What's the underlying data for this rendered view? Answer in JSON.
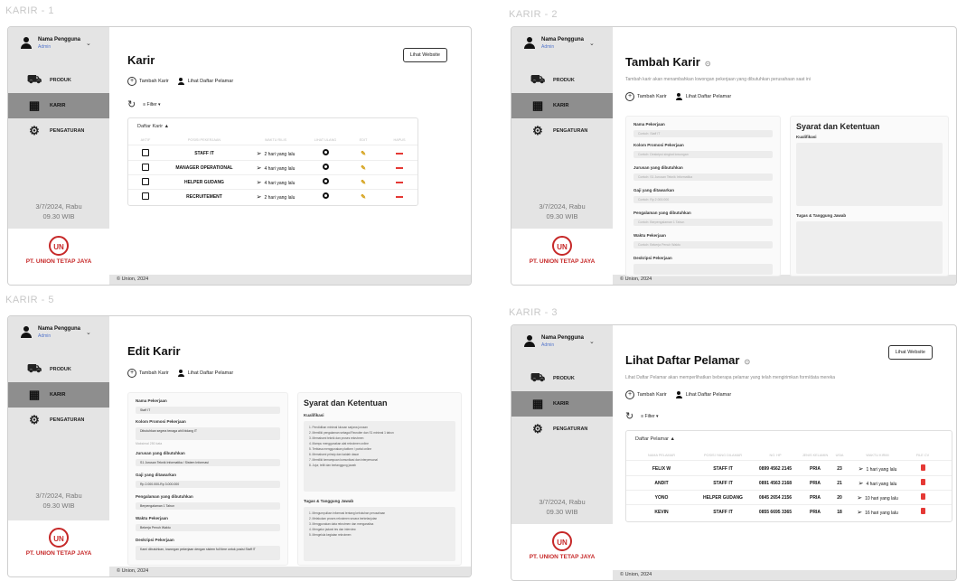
{
  "labels": {
    "p1": "KARIR - 1",
    "p2": "KARIR - 2",
    "p3": "KARIR - 5",
    "p4": "KARIR - 3"
  },
  "sidebar": {
    "user_name": "Nama Pengguna",
    "user_role": "Admin",
    "nav": [
      "PRODUK",
      "KARIR",
      "PENGATURAN"
    ],
    "date": "3/7/2024, Rabu",
    "time": "09.30 WIB",
    "company": "PT. UNION TETAP JAYA",
    "logo_text": "UN"
  },
  "footer": "© Union, 2024",
  "common": {
    "add_career": "Tambah Karir",
    "view_applicants": "Lihat Daftar Pelamar",
    "filter": "Filter ▾",
    "view_website": "Lihat Website"
  },
  "karir1": {
    "title": "Karir",
    "table_title": "Daftar Karir ▲",
    "headers": [
      "AKTIF",
      "POSISI PEKERJAAN",
      "WAKTU RILIS",
      "LIHAT ULANG",
      "EDIT",
      "HAPUS"
    ],
    "rows": [
      {
        "pos": "STAFF IT",
        "time": "2 hari yang lalu"
      },
      {
        "pos": "MANAGER OPERATIONAL",
        "time": "4 hari yang lalu"
      },
      {
        "pos": "HELPER GUDANG",
        "time": "4 hari yang lalu"
      },
      {
        "pos": "RECRUITEMENT",
        "time": "2 hari yang lalu"
      }
    ]
  },
  "karir2": {
    "title": "Tambah Karir",
    "desc": "Tambah karir akan menambahkan lowongan pekerjaan yang dibutuhkan perusahaan saat ini",
    "fields": [
      "Nama Pekerjaan",
      "Kolom Promosi Pekerjaan",
      "Jurusan yang dibutuhkan",
      "Gaji yang ditawarkan",
      "Pengalaman yang dibutuhkan",
      "Waktu Pekerjaan",
      "Deskripsi Pekerjaan"
    ],
    "placeholders": [
      "Contoh: Staff IT",
      "Contoh: Deskripsi singkat lowongan",
      "Contoh: S1 Jurusan Teknik Informatika",
      "Contoh: Rp 2.000.000",
      "Contoh: Berpengalaman 1 Tahun",
      "Contoh: Bekerja Penuh Waktu",
      ""
    ],
    "syarat_title": "Syarat dan Ketentuan",
    "kualifikasi": "Kualifikasi",
    "tanggung": "Tugas & Tanggung Jawab"
  },
  "karir5": {
    "title": "Edit Karir",
    "values": [
      "Staff IT",
      "Dibutuhkan segera tenaga ahli bidang IT",
      "S1 Jurusan Teknik Informatika / Sistem Informasi",
      "Rp 2.000.000-Rp 3.000.000",
      "Berpengalaman 1 Tahun",
      "Bekerja Penuh Waktu",
      "Kami dibutuhkan, lowongan pekerjaan dengan sistem full time untuk posisi Staff IT"
    ],
    "hint": "Maksimal 250 kata",
    "kual_items": [
      "1. Pendidikan minimal lulusan sarjana jurusan",
      "2. Memiliki pengalaman sebagai Recruiter dan S1 minimal 1 tahun",
      "3. Memahami teknik dan proses rekrutmen",
      "4. Mampu menggunakan alat rekrutmen online",
      "5. Terbiasa menggunakan platform / portal online",
      "6. Memahami prinsip dan kaidah dasar",
      "7. Memiliki kemampuan komunikasi dan interpersonal",
      "8. Jujur, teliti dan bertanggung jawab"
    ],
    "tug_items": [
      "1. Mengumpulkan informasi tentang kebutuhan perusahaan",
      "2. Melakukan proses rekrutmen secara berkelanjutan",
      "3. Menggunakan data rekrutmen dan menganalisa",
      "4. Mengatur jadwal tes dan interview",
      "5. Mengelola kegiatan rekrutmen"
    ]
  },
  "karir3": {
    "title": "Lihat Daftar Pelamar",
    "desc": "Lihat Daftar Pelamar akan memperlihatkan beberapa pelamar yang telah mengirimkan form/data mereka",
    "table_title": "Daftar Pelamar ▲",
    "headers": [
      "NAMA PELAMAR",
      "POSISI YANG DILAMAR",
      "NO. HP",
      "JENIS KELAMIN",
      "USIA",
      "WAKTU KIRIM",
      "FILE CV"
    ],
    "rows": [
      {
        "name": "FELIX W",
        "pos": "STAFF IT",
        "hp": "0899 4562 2145",
        "sex": "PRIA",
        "age": "23",
        "time": "1 hari yang lalu"
      },
      {
        "name": "ANDIT",
        "pos": "STAFF IT",
        "hp": "0891 4563 2168",
        "sex": "PRIA",
        "age": "21",
        "time": "4 hari yang lalu"
      },
      {
        "name": "YONO",
        "pos": "HELPER GUDANG",
        "hp": "0845 2654 2156",
        "sex": "PRIA",
        "age": "20",
        "time": "10 hari yang lalu"
      },
      {
        "name": "KEVIN",
        "pos": "STAFF IT",
        "hp": "0855 6695 3365",
        "sex": "PRIA",
        "age": "18",
        "time": "16 hari yang lalu"
      }
    ]
  }
}
